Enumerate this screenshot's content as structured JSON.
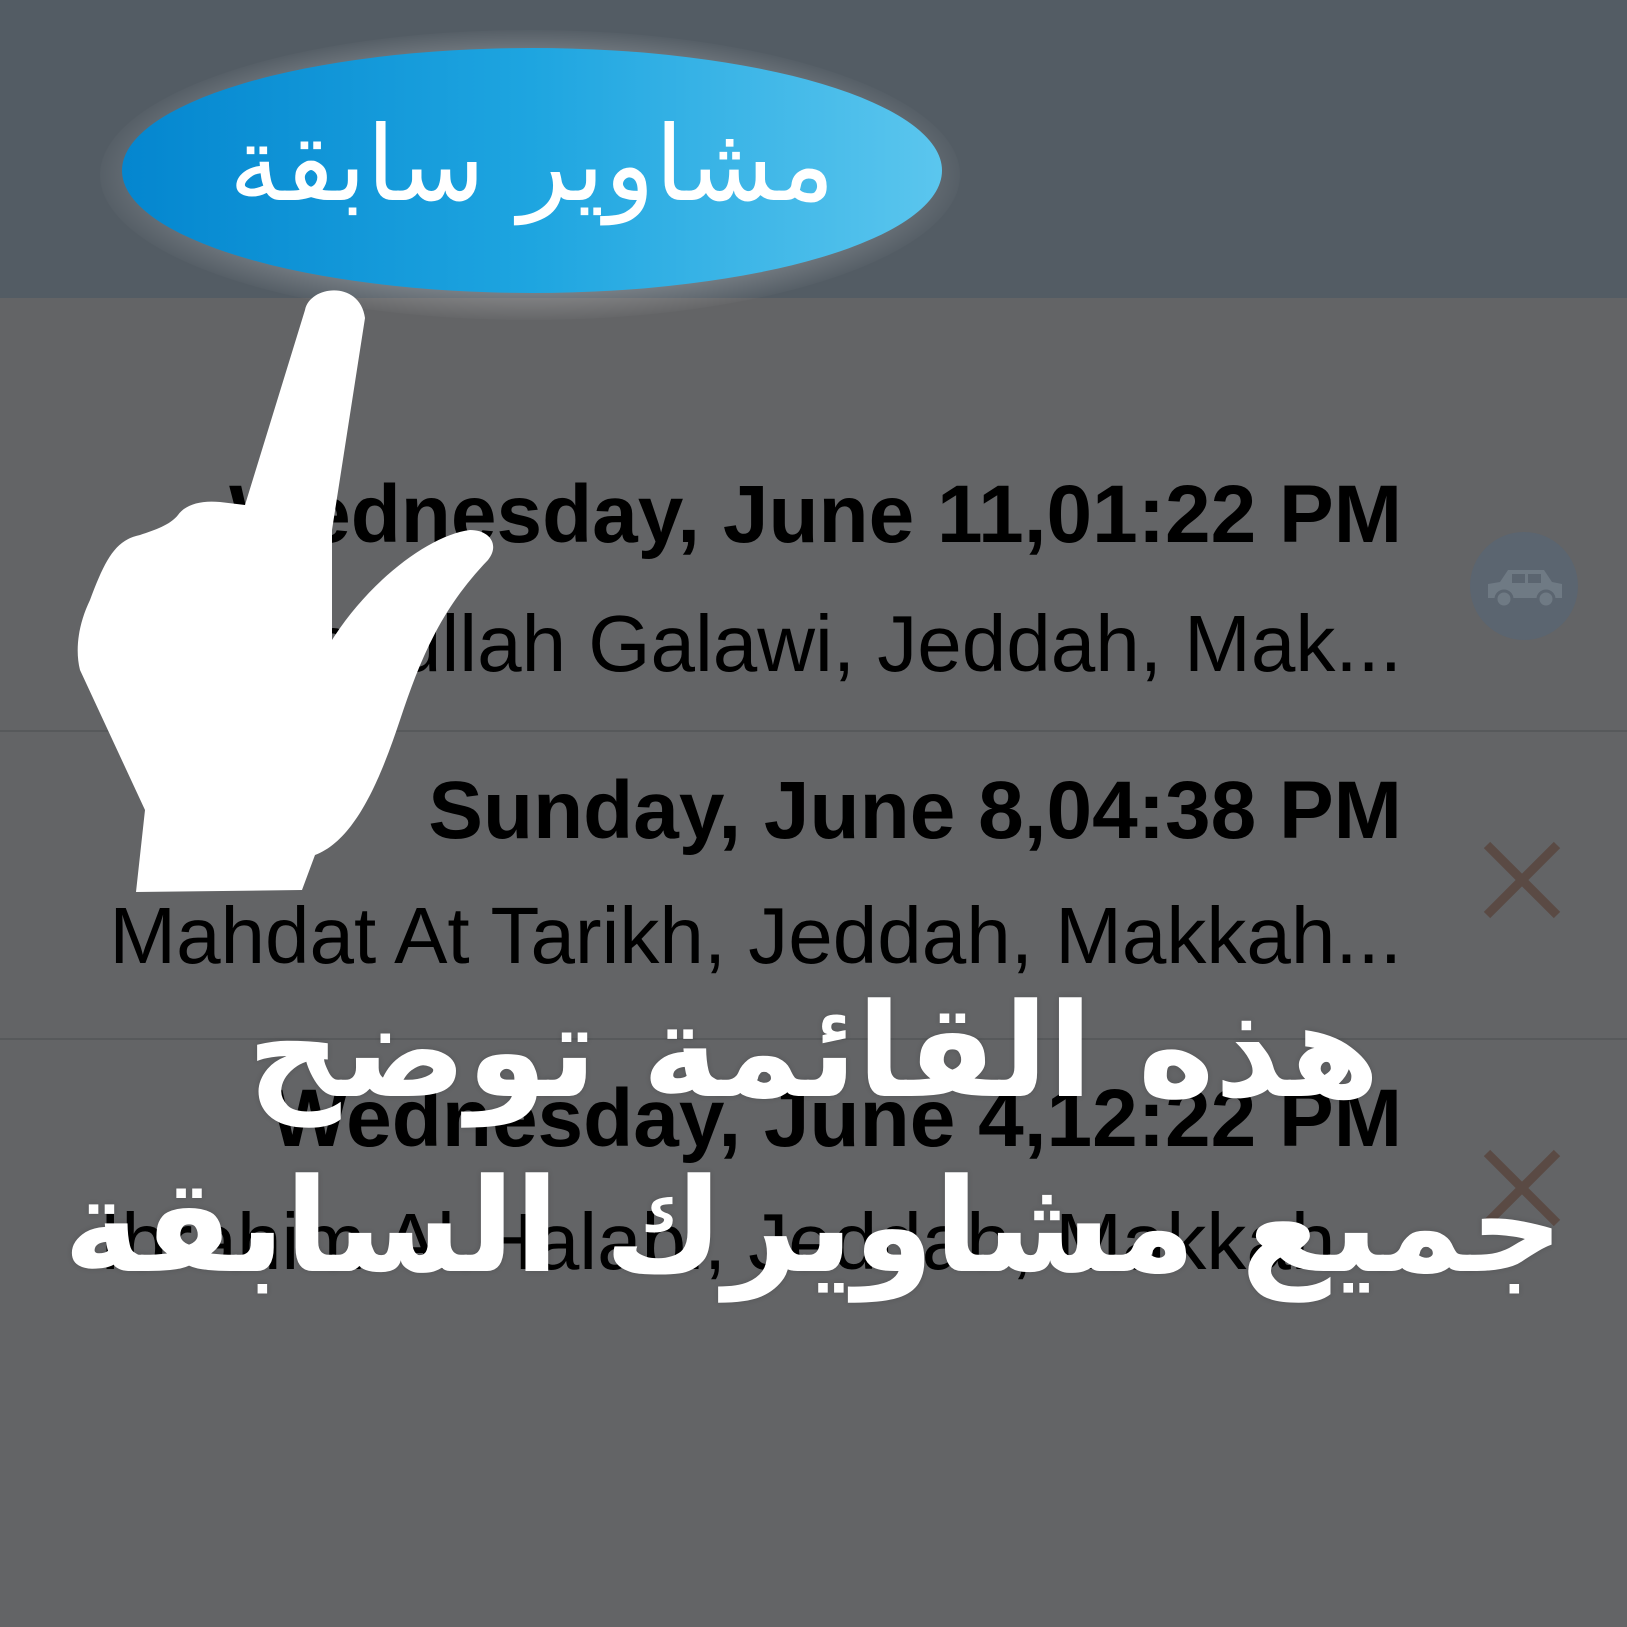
{
  "header": {
    "title": "مشاوير سابقة"
  },
  "history": {
    "rows": [
      {
        "title": "Wednesday, June 11,01:22 PM",
        "subtitle": "Abdullah Galawi, Jeddah, Mak...",
        "action_icon": "car-icon"
      },
      {
        "title": "Sunday, June 8,04:38 PM",
        "subtitle": "Mahdat At Tarikh, Jeddah, Makkah...",
        "action_icon": "close-icon"
      },
      {
        "title": "Wednesday, June 4,12:22 PM",
        "subtitle": "Ibrahim Al Halabi, Jeddah, Makkah...",
        "action_icon": "close-icon"
      }
    ]
  },
  "tutorial": {
    "line1": "هذه القائمة توضح",
    "line2": "جميع مشاويرك السابقة",
    "pointer_icon": "hand-pointer-icon"
  },
  "colors": {
    "accent_blue": "#1ea5e0",
    "header_bg": "#535c64",
    "overlay_bg": "#636466",
    "delete_x": "#5a4a44"
  }
}
